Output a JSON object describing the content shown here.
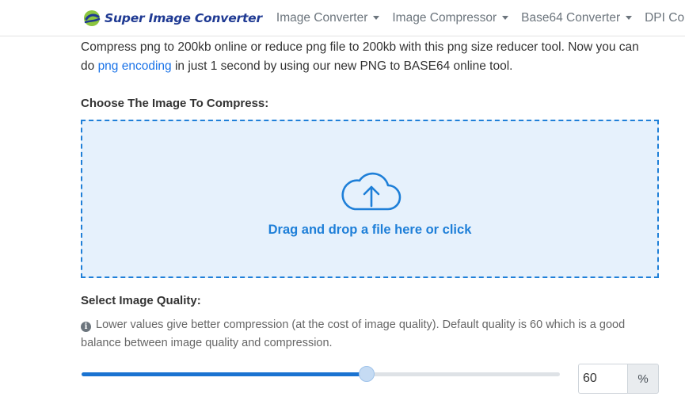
{
  "nav": {
    "brand": "Super Image Converter",
    "items": [
      {
        "label": "Image Converter"
      },
      {
        "label": "Image Compressor"
      },
      {
        "label": "Base64 Converter"
      },
      {
        "label": "DPI Co"
      }
    ]
  },
  "intro": {
    "before_link": "Compress png to 200kb online or reduce png file to 200kb with this png size reducer tool. Now you can do ",
    "link_text": "png encoding",
    "after_link": " in just 1 second by using our new PNG to BASE64 online tool."
  },
  "upload": {
    "label": "Choose The Image To Compress:",
    "drop_text": "Drag and drop a file here or click",
    "icon": "cloud-upload-icon"
  },
  "quality": {
    "label": "Select Image Quality:",
    "info_icon": "info-icon",
    "hint": "Lower values give better compression (at the cost of image quality). Default quality is 60 which is a good balance between image quality and compression.",
    "value": "60",
    "unit": "%",
    "slider_fraction": 0.596
  },
  "colors": {
    "accent": "#1e7fd8",
    "brand": "#1f3a93",
    "dropzone_bg": "#e6f1fc",
    "logo_green": "#8cc63f"
  }
}
